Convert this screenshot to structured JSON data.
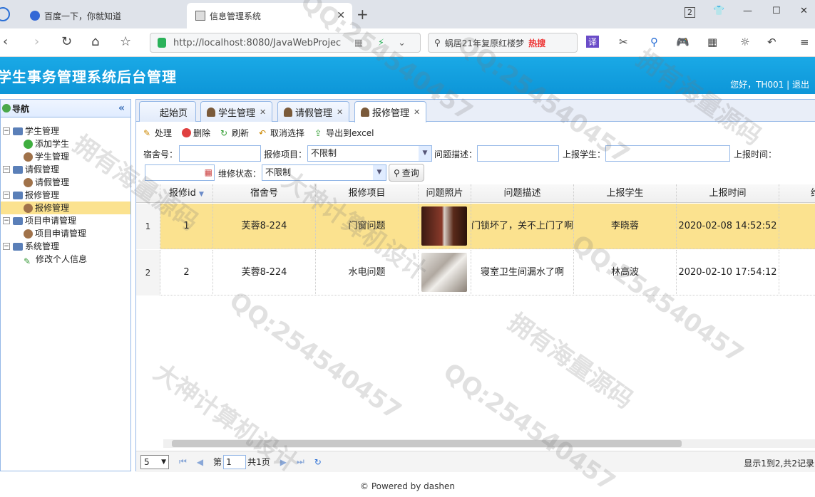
{
  "browser": {
    "tab1_title": "百度一下，你就知道",
    "tab2_title": "信息管理系统",
    "url": "http://localhost:8080/JavaWebProjec",
    "search_text": "蜗居21年复原红楼梦",
    "search_hot": "热搜",
    "tab_count": "2"
  },
  "app": {
    "title": "学生事务管理系统后台管理",
    "greeting": "您好，TH001 | 退出"
  },
  "nav": {
    "header": "导航",
    "collapse": "«",
    "groups": [
      {
        "label": "学生管理",
        "children": [
          "添加学生",
          "学生管理"
        ]
      },
      {
        "label": "请假管理",
        "children": [
          "请假管理"
        ]
      },
      {
        "label": "报修管理",
        "children": [
          "报修管理"
        ]
      },
      {
        "label": "项目申请管理",
        "children": [
          "项目申请管理"
        ]
      },
      {
        "label": "系统管理",
        "children": [
          "修改个人信息"
        ]
      }
    ]
  },
  "tabs": [
    "起始页",
    "学生管理",
    "请假管理",
    "报修管理"
  ],
  "actions": [
    "处理",
    "删除",
    "刷新",
    "取消选择",
    "导出到excel"
  ],
  "filters": {
    "dorm_label": "宿舍号：",
    "item_label": "报修项目：",
    "item_value": "不限制",
    "desc_label": "问题描述：",
    "reporter_label": "上报学生：",
    "time_label": "上报时间：",
    "status_label": "维修状态：",
    "status_value": "不限制",
    "query": "查询"
  },
  "grid": {
    "columns": [
      "报修id",
      "宿舍号",
      "报修项目",
      "问题照片",
      "问题描述",
      "上报学生",
      "上报时间",
      "维"
    ],
    "rows": [
      {
        "rn": "1",
        "id": "1",
        "dorm": "芙蓉8-224",
        "item": "门窗问题",
        "desc": "门锁坏了，关不上门了啊",
        "student": "李晓蓉",
        "time": "2020-02-08 14:52:52"
      },
      {
        "rn": "2",
        "id": "2",
        "dorm": "芙蓉8-224",
        "item": "水电问题",
        "desc": "寝室卫生间漏水了啊",
        "student": "林高波",
        "time": "2020-02-10 17:54:12"
      }
    ]
  },
  "pager": {
    "size": "5",
    "page_prefix": "第",
    "page": "1",
    "page_suffix": "共1页",
    "info": "显示1到2,共2记录"
  },
  "footer": "© Powered by dashen",
  "watermarks": [
    "拥有海量源码",
    "QQ:254540457",
    "大神计算机设计"
  ]
}
